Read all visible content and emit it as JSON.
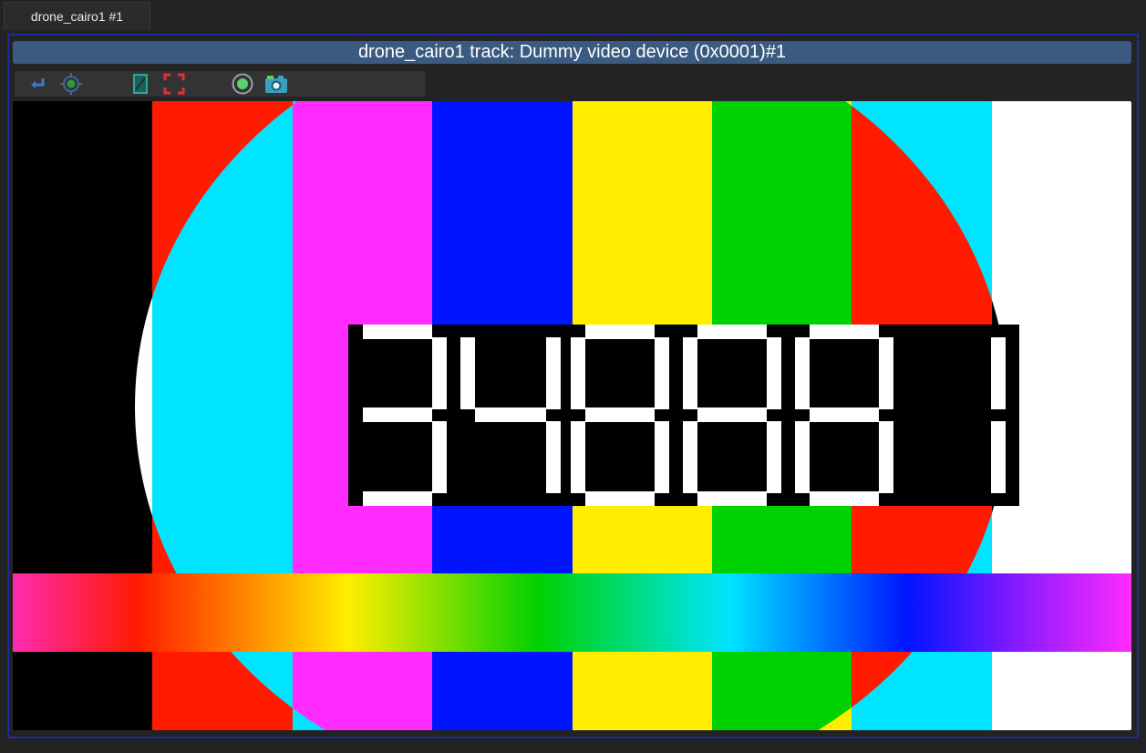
{
  "tab": {
    "label": "drone_cairo1 #1"
  },
  "panel": {
    "title": "drone_cairo1 track: Dummy video device (0x0001)#1"
  },
  "toolbar": {
    "buttons": [
      {
        "icon": "return-icon",
        "color": "#3a7bd5"
      },
      {
        "icon": "target-icon",
        "color": "#2e8b3e"
      },
      {
        "icon": "picture-frame-icon",
        "color": "#2a9a8a"
      },
      {
        "icon": "fullscreen-icon",
        "color": "#e03030"
      },
      {
        "icon": "record-icon",
        "color": "#5fd06f"
      },
      {
        "icon": "camera-icon",
        "color": "#3aa0c0"
      }
    ]
  },
  "video": {
    "pattern": "color-bars-test-card",
    "timecode": "34888 1",
    "bar_colors": [
      "#000000",
      "#ff1a00",
      "#00e5ff",
      "#ff2bff",
      "#0014ff",
      "#ffee00",
      "#00d100",
      "#ff1a00",
      "#00e5ff",
      "#ffffff"
    ]
  }
}
